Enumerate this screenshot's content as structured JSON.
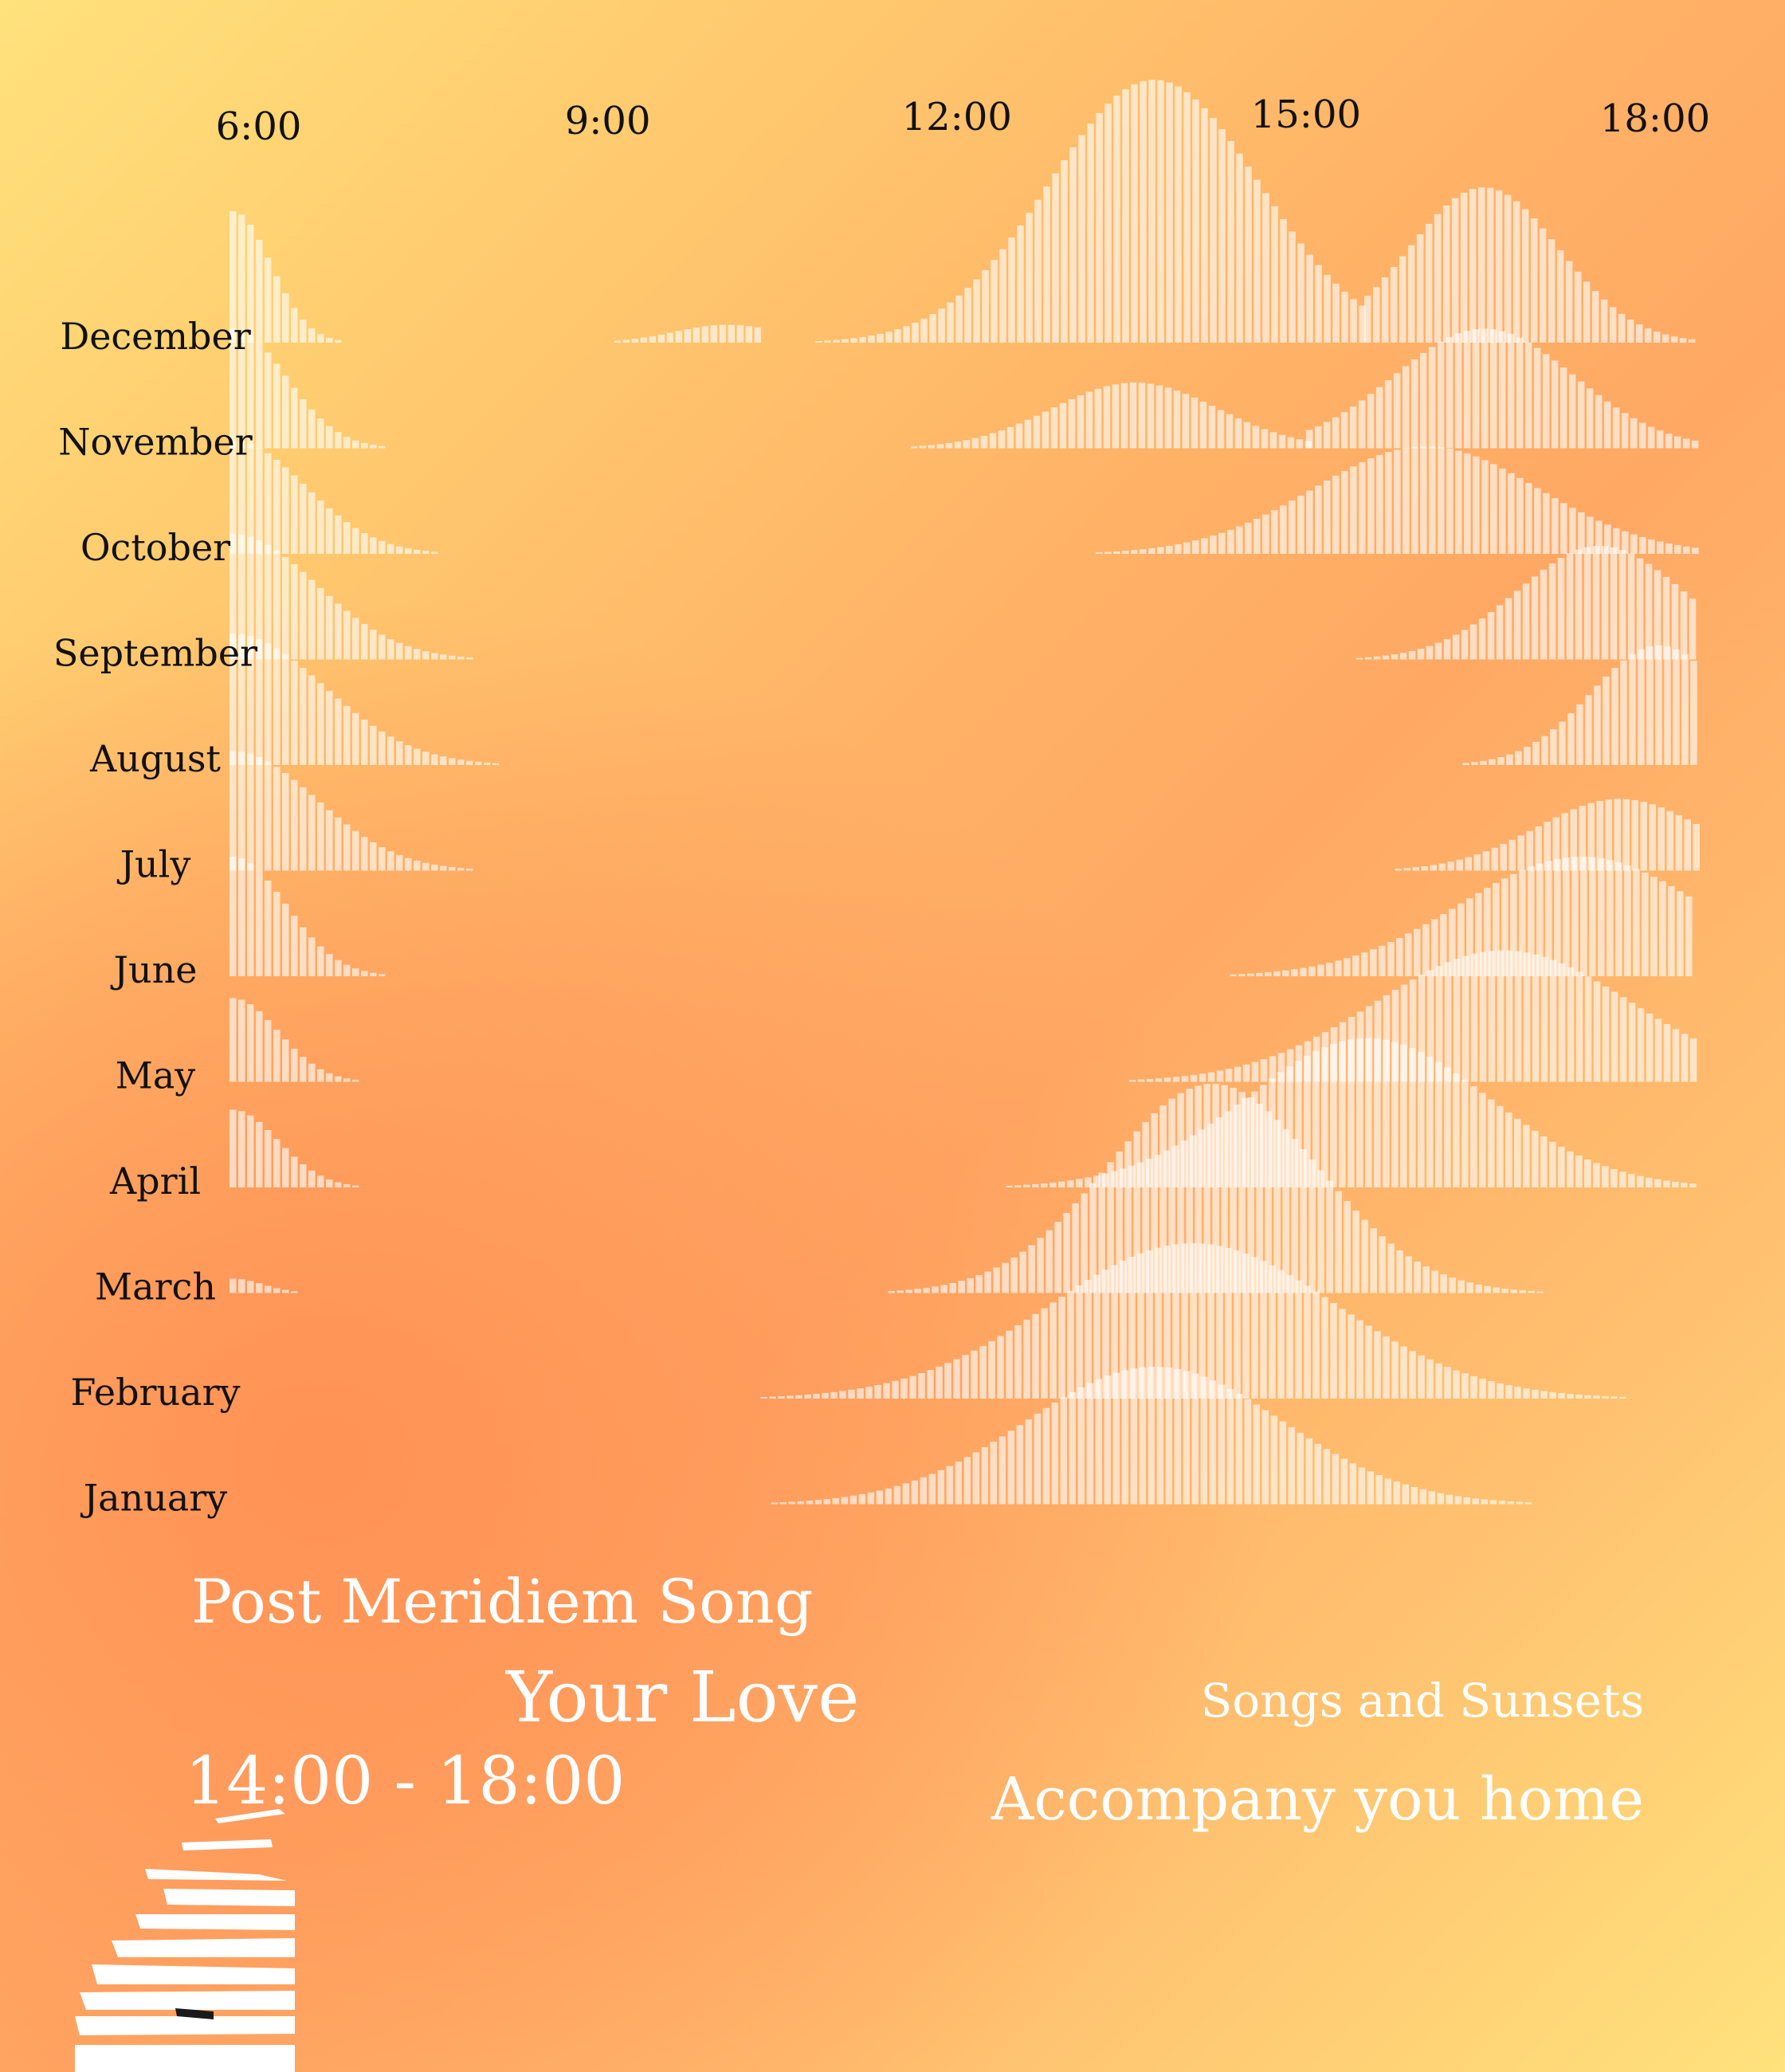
{
  "chart_data": {
    "type": "area",
    "x_ticks": [
      "6:00",
      "9:00",
      "12:00",
      "15:00",
      "18:00"
    ],
    "xlim": [
      "5:45",
      "18:30"
    ],
    "months": [
      "December",
      "November",
      "October",
      "September",
      "August",
      "July",
      "June",
      "May",
      "April",
      "March",
      "February",
      "January"
    ],
    "series": [
      {
        "month": "December",
        "peaks": [
          {
            "x": "5:45",
            "h": 1.1,
            "w": 0.5,
            "skew": "right",
            "from": "5:45",
            "to": "7:00"
          },
          {
            "x": "10:00",
            "h": 0.15,
            "w": 0.7,
            "from": "8:00",
            "to": "10:20"
          },
          {
            "x": "13:40",
            "h": 2.2,
            "w": 1.4,
            "from": "10:20",
            "to": "15:30"
          },
          {
            "x": "16:30",
            "h": 1.3,
            "w": 1.0,
            "from": "15:30",
            "to": "18:20"
          }
        ]
      },
      {
        "month": "November",
        "peaks": [
          {
            "x": "5:45",
            "h": 1.0,
            "w": 0.7,
            "skew": "right",
            "from": "5:45",
            "to": "8:00"
          },
          {
            "x": "13:30",
            "h": 0.55,
            "w": 1.1,
            "from": "11:00",
            "to": "15:00"
          },
          {
            "x": "16:30",
            "h": 1.0,
            "w": 1.2,
            "from": "15:00",
            "to": "18:20"
          }
        ]
      },
      {
        "month": "October",
        "peaks": [
          {
            "x": "5:45",
            "h": 0.95,
            "w": 0.95,
            "skew": "right",
            "from": "5:45",
            "to": "9:00"
          },
          {
            "x": "16:00",
            "h": 0.9,
            "w": 1.5,
            "from": "12:40",
            "to": "18:20"
          }
        ]
      },
      {
        "month": "September",
        "peaks": [
          {
            "x": "5:45",
            "h": 1.05,
            "w": 1.1,
            "skew": "right",
            "from": "5:45",
            "to": "9:10"
          },
          {
            "x": "17:30",
            "h": 0.95,
            "w": 1.1,
            "from": "14:00",
            "to": "18:20"
          }
        ]
      },
      {
        "month": "August",
        "peaks": [
          {
            "x": "5:45",
            "h": 1.1,
            "w": 1.2,
            "skew": "right",
            "from": "5:45",
            "to": "9:30"
          },
          {
            "x": "18:00",
            "h": 1.0,
            "w": 0.9,
            "from": "15:40",
            "to": "18:20"
          }
        ]
      },
      {
        "month": "July",
        "peaks": [
          {
            "x": "5:45",
            "h": 1.0,
            "w": 1.1,
            "skew": "right",
            "from": "5:45",
            "to": "9:20"
          },
          {
            "x": "17:40",
            "h": 0.6,
            "w": 1.1,
            "from": "14:20",
            "to": "18:20"
          }
        ]
      },
      {
        "month": "June",
        "peaks": [
          {
            "x": "5:45",
            "h": 1.0,
            "w": 0.7,
            "skew": "right",
            "from": "5:45",
            "to": "7:50"
          },
          {
            "x": "17:20",
            "h": 1.0,
            "w": 1.6,
            "from": "13:40",
            "to": "18:20"
          }
        ]
      },
      {
        "month": "May",
        "peaks": [
          {
            "x": "5:45",
            "h": 0.7,
            "w": 0.6,
            "skew": "right",
            "from": "5:45",
            "to": "7:30"
          },
          {
            "x": "16:40",
            "h": 1.1,
            "w": 1.7,
            "from": "12:30",
            "to": "18:20"
          }
        ]
      },
      {
        "month": "April",
        "peaks": [
          {
            "x": "5:45",
            "h": 0.65,
            "w": 0.6,
            "skew": "right",
            "from": "5:45",
            "to": "7:30"
          },
          {
            "x": "15:30",
            "h": 1.25,
            "w": 1.6,
            "from": "11:40",
            "to": "18:20"
          }
        ]
      },
      {
        "month": "March",
        "peaks": [
          {
            "x": "5:45",
            "h": 0.12,
            "w": 0.4,
            "skew": "right",
            "from": "5:45",
            "to": "7:00"
          },
          {
            "x": "14:10",
            "h": 1.75,
            "w": 1.4,
            "from": "11:20",
            "to": "18:20"
          }
        ]
      },
      {
        "month": "February",
        "peaks": [
          {
            "x": "14:00",
            "h": 1.3,
            "w": 1.9,
            "from": "9:20",
            "to": "18:20"
          }
        ]
      },
      {
        "month": "January",
        "peaks": [
          {
            "x": "13:40",
            "h": 1.15,
            "w": 1.7,
            "from": "9:30",
            "to": "17:20"
          }
        ]
      }
    ]
  },
  "text": {
    "title": "Post Meridiem Song",
    "song": "Your Love",
    "time_range": "14:00 - 18:00",
    "series": "Songs and Sunsets",
    "tagline": "Accompany you home"
  },
  "colors": {
    "fill": "#ffffff",
    "label": "#111111"
  },
  "icons": [
    "piano-keys-icon"
  ]
}
